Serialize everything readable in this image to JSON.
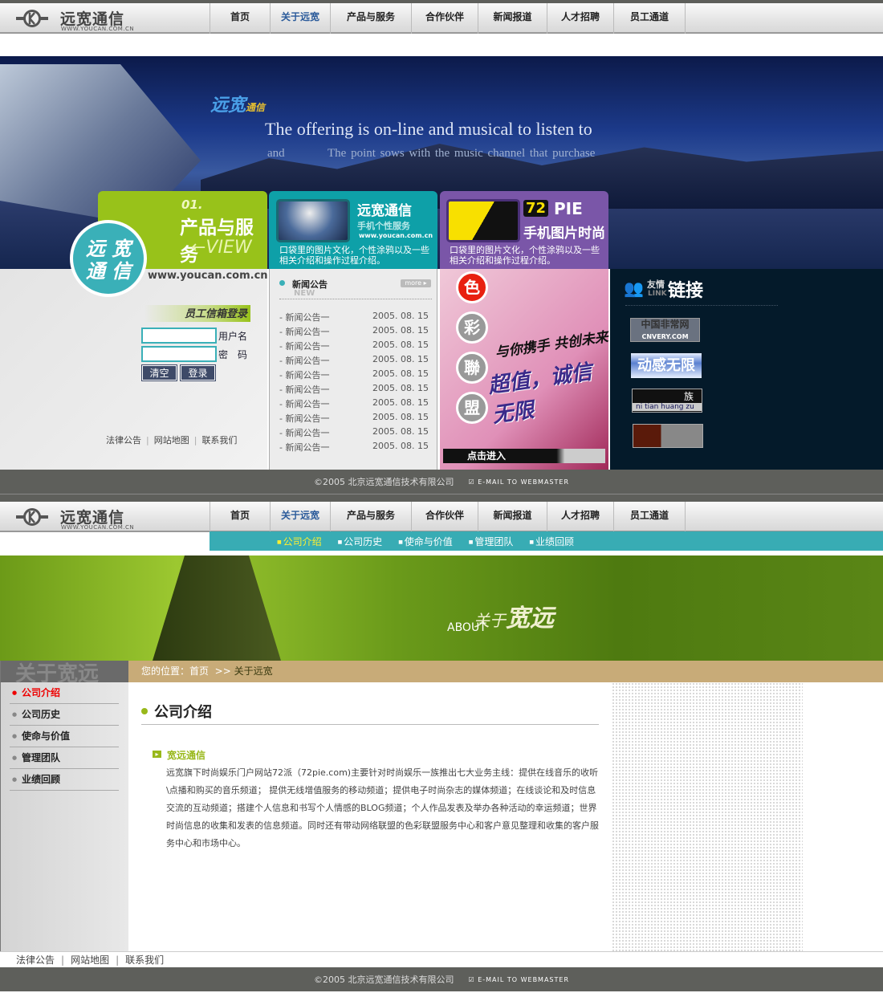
{
  "brand": {
    "name": "远宽通信",
    "url": "WWW.YOUCAN.COM.CN"
  },
  "nav": [
    {
      "label": "首页"
    },
    {
      "label": "关于远宽",
      "active": true
    },
    {
      "label": "产品与服务"
    },
    {
      "label": "合作伙伴"
    },
    {
      "label": "新闻报道"
    },
    {
      "label": "人才招聘"
    },
    {
      "label": "员工通道"
    }
  ],
  "home": {
    "banner": {
      "brand": "远宽",
      "brand_sub": "通信",
      "line1": "The offering is on-line and musical to listen to",
      "line2_a": "and",
      "line2_b": "The point sows with the music channel that purchase"
    },
    "product_panel": {
      "num": "01.",
      "title": "产品与服务",
      "view": "←VIEW",
      "circle": "远 宽 通 信",
      "site": "www.youcan.com.cn"
    },
    "teal_panel": {
      "title": "远宽通信",
      "subtitle": "手机个性服务",
      "url": "www.youcan.com.cn",
      "desc": "口袋里的图片文化，个性涂鸦以及一些相关介绍和操作过程介绍。"
    },
    "purple_panel": {
      "badge": "72",
      "title": "PIE",
      "subtitle": "手机图片时尚",
      "desc": "口袋里的图片文化，个性涂鸦以及一些相关介绍和操作过程介绍。"
    },
    "login": {
      "title": "员工信箱登录",
      "username_label": "用户名",
      "password_label": "密　码",
      "username_value": "",
      "password_value": "",
      "clear": "清空",
      "login": "登录"
    },
    "left_links": [
      "法律公告",
      "网站地图",
      "联系我们"
    ],
    "news": {
      "title": "新闻公告",
      "title_en": "NEW",
      "more": "more",
      "items": [
        {
          "title": "- 新闻公告一",
          "date": "2005. 08. 15"
        },
        {
          "title": "- 新闻公告一",
          "date": "2005. 08. 15"
        },
        {
          "title": "- 新闻公告一",
          "date": "2005. 08. 15"
        },
        {
          "title": "- 新闻公告一",
          "date": "2005. 08. 15"
        },
        {
          "title": "- 新闻公告一",
          "date": "2005. 08. 15"
        },
        {
          "title": "- 新闻公告一",
          "date": "2005. 08. 15"
        },
        {
          "title": "- 新闻公告一",
          "date": "2005. 08. 15"
        },
        {
          "title": "- 新闻公告一",
          "date": "2005. 08. 15"
        },
        {
          "title": "- 新闻公告一",
          "date": "2005. 08. 15"
        },
        {
          "title": "- 新闻公告一",
          "date": "2005. 08. 15"
        }
      ]
    },
    "league": {
      "chars": [
        "色",
        "彩",
        "聯",
        "盟"
      ],
      "slogan1": "与你携手 共创未来",
      "slogan2": "超值，诚信无限",
      "enter": "点击进入"
    },
    "friend_links": {
      "title_small": "友情",
      "title_en": "LINK",
      "title": "链接",
      "items": [
        {
          "label": "中国非常网",
          "sub": "CNVERY.COM"
        },
        {
          "label": "动感无限"
        },
        {
          "label": "族",
          "sub": "ni tian huang zu"
        },
        {
          "label": ""
        }
      ]
    }
  },
  "footer": {
    "copyright": "©2005  北京远宽通信技术有限公司",
    "email": "E-MAIL TO WEBMASTER"
  },
  "about": {
    "subnav": [
      {
        "label": "公司介绍",
        "active": true
      },
      {
        "label": "公司历史"
      },
      {
        "label": "使命与价值"
      },
      {
        "label": "管理团队"
      },
      {
        "label": "业绩回顾"
      }
    ],
    "banner": {
      "title_a": "关于",
      "title_b": "宽远",
      "title_en": "ABOUT"
    },
    "sidebar_title": "关于宽远",
    "sidebar": [
      {
        "label": "公司介绍",
        "active": true
      },
      {
        "label": "公司历史"
      },
      {
        "label": "使命与价值"
      },
      {
        "label": "管理团队"
      },
      {
        "label": "业绩回顾"
      }
    ],
    "breadcrumb": {
      "prefix": "您的位置：",
      "home": "首页",
      "sep": ">>",
      "current": "关于远宽"
    },
    "title": "公司介绍",
    "section": "宽远通信",
    "paragraph": "远宽旗下时尚娱乐门户网站72派（72pie.com)主要针对时尚娱乐一族推出七大业务主线：提供在线音乐的收听\\点播和购买的音乐频道； 提供无线增值服务的移动频道；提供电子时尚杂志的媒体频道；在线谈论和及时信息交流的互动频道；搭建个人信息和书写个人情感的BLOG频道；个人作品发表及举办各种活动的幸运频道；世界时尚信息的收集和发表的信息频道。同时还有带动网络联盟的色彩联盟服务中心和客户意见整理和收集的客户服务中心和市场中心。",
    "footer_links": [
      "法律公告",
      "网站地图",
      "联系我们"
    ]
  },
  "colors": {
    "teal": "#38acb4",
    "green": "#98c21a",
    "purple": "#7a56a8",
    "footer": "#5e5f5b",
    "tan": "#c8ab78"
  }
}
